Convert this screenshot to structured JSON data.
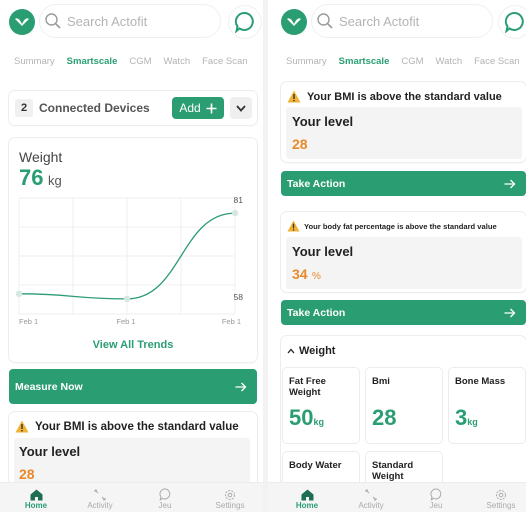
{
  "search": {
    "placeholder": "Search Actofit"
  },
  "tabs": [
    "Summary",
    "Smartscale",
    "CGM",
    "Watch",
    "Face Scan"
  ],
  "active_tab": "Smartscale",
  "devices": {
    "count": "2",
    "label": "Connected Devices",
    "add_label": "Add"
  },
  "weight_card": {
    "title": "Weight",
    "value": "76",
    "unit": "kg",
    "link": "View All Trends"
  },
  "chart_data": {
    "type": "line",
    "x": [
      "Feb 1",
      "Feb 1",
      "Feb 1"
    ],
    "values": [
      62,
      61,
      78
    ],
    "y_max_label": "81",
    "y_min_label": "58",
    "ylim": [
      58,
      81
    ],
    "grid": true
  },
  "measure": {
    "label": "Measure Now"
  },
  "bmi_alert": {
    "title": "Your BMI is above the standard value",
    "level_label": "Your level",
    "value": "28",
    "action": "Take Action"
  },
  "fat_alert": {
    "title": "Your body fat percentage is above the standard value",
    "level_label": "Your level",
    "value": "34",
    "unit": "%",
    "action": "Take Action"
  },
  "weight_section": {
    "title": "Weight",
    "metrics": [
      {
        "label": "Fat Free Weight",
        "value": "50",
        "unit": "kg"
      },
      {
        "label": "Bmi",
        "value": "28",
        "unit": ""
      },
      {
        "label": "Bone Mass",
        "value": "3",
        "unit": "kg"
      },
      {
        "label": "Body Water",
        "value": "",
        "unit": ""
      },
      {
        "label": "Standard Weight",
        "value": "",
        "unit": ""
      }
    ]
  },
  "nav": [
    "Home",
    "Activity",
    "Jeu",
    "Settings"
  ],
  "colors": {
    "primary": "#2a9d72",
    "warning": "#e8892a",
    "warning_icon": "#f2b233"
  }
}
